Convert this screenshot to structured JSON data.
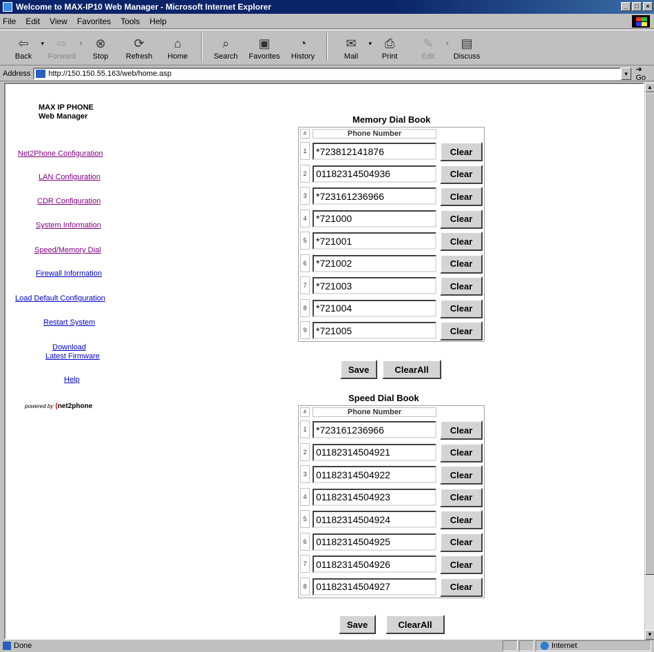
{
  "window": {
    "title": "Welcome to MAX-IP10 Web Manager - Microsoft Internet Explorer"
  },
  "menu": [
    "File",
    "Edit",
    "View",
    "Favorites",
    "Tools",
    "Help"
  ],
  "toolbar": {
    "back": "Back",
    "forward": "Forward",
    "stop": "Stop",
    "refresh": "Refresh",
    "home": "Home",
    "search": "Search",
    "favorites": "Favorites",
    "history": "History",
    "mail": "Mail",
    "print": "Print",
    "edit": "Edit",
    "discuss": "Discuss"
  },
  "address": {
    "label": "Address",
    "url": "http://150.150.55.163/web/home.asp",
    "go": "Go"
  },
  "sidebar": {
    "brand_line1": "MAX IP PHONE",
    "brand_line2": "Web Manager",
    "links": [
      {
        "label": "Net2Phone Configuration",
        "visited": true
      },
      {
        "label": "LAN Configuration",
        "visited": true
      },
      {
        "label": "CDR Configuration",
        "visited": true
      },
      {
        "label": "System Information",
        "visited": true
      },
      {
        "label": "Speed/Memory Dial",
        "visited": true
      },
      {
        "label": "Firewall Information",
        "visited": false
      },
      {
        "label": "Load Default Configuration",
        "visited": false
      },
      {
        "label": "Restart System",
        "visited": false
      },
      {
        "label": "Download",
        "visited": false
      },
      {
        "label": "Latest Firmware",
        "visited": false
      },
      {
        "label": "Help",
        "visited": false
      }
    ],
    "powered_by": "powered by",
    "powered_brand": "net2phone"
  },
  "memory_book": {
    "title": "Memory Dial Book",
    "index_header": "#",
    "column_header": "Phone Number",
    "clear_label": "Clear",
    "entries": [
      {
        "n": "1",
        "number": "*723812141876"
      },
      {
        "n": "2",
        "number": "01182314504936"
      },
      {
        "n": "3",
        "number": "*723161236966"
      },
      {
        "n": "4",
        "number": "*721000"
      },
      {
        "n": "5",
        "number": "*721001"
      },
      {
        "n": "6",
        "number": "*721002"
      },
      {
        "n": "7",
        "number": "*721003"
      },
      {
        "n": "8",
        "number": "*721004"
      },
      {
        "n": "9",
        "number": "*721005"
      }
    ],
    "save_label": "Save",
    "clearall_label": "ClearAll"
  },
  "speed_book": {
    "title": "Speed Dial Book",
    "index_header": "#",
    "column_header": "Phone Number",
    "clear_label": "Clear",
    "entries": [
      {
        "n": "1",
        "number": "*723161236966"
      },
      {
        "n": "2",
        "number": "01182314504921"
      },
      {
        "n": "3",
        "number": "01182314504922"
      },
      {
        "n": "4",
        "number": "01182314504923"
      },
      {
        "n": "5",
        "number": "01182314504924"
      },
      {
        "n": "6",
        "number": "01182314504925"
      },
      {
        "n": "7",
        "number": "01182314504926"
      },
      {
        "n": "8",
        "number": "01182314504927"
      }
    ],
    "save_label": "Save",
    "clearall_label": "ClearAll"
  },
  "status": {
    "text": "Done",
    "zone": "Internet"
  }
}
